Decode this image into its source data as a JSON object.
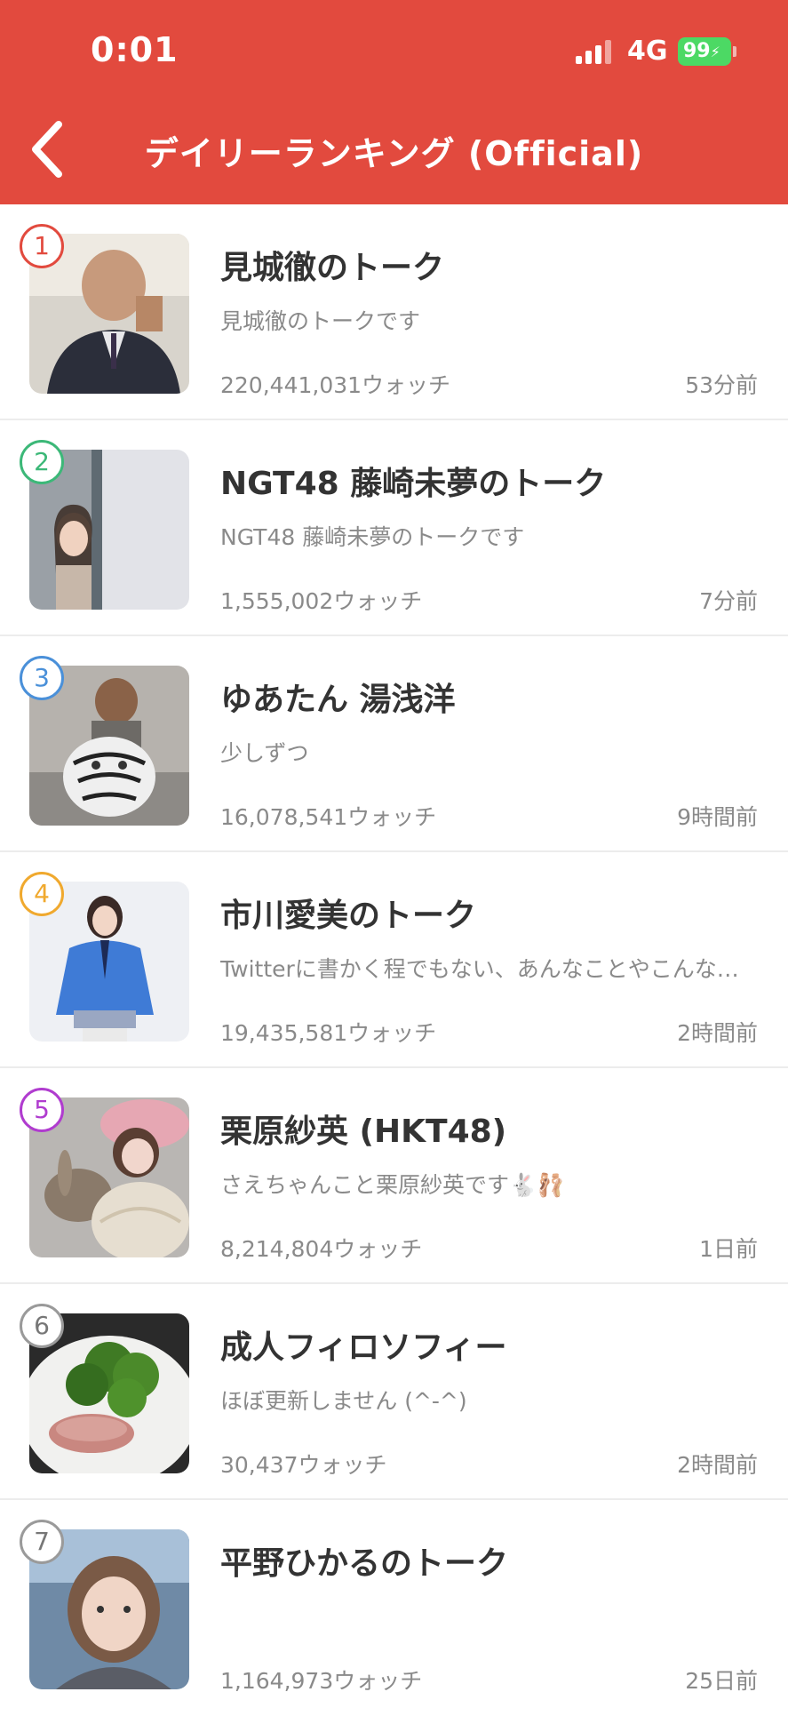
{
  "status_bar": {
    "time": "0:01",
    "network": "4G",
    "battery": "99"
  },
  "header": {
    "back_icon": "chevron-left-icon",
    "title": "デイリーランキング (Official)"
  },
  "ranking": [
    {
      "rank": "1",
      "rank_color": "#e24a3e",
      "name": "見城徹のトーク",
      "description": "見城徹のトークです",
      "watch": "220,441,031ウォッチ",
      "time": "53分前"
    },
    {
      "rank": "2",
      "rank_color": "#3cb878",
      "name": "NGT48 藤崎未夢のトーク",
      "description": "NGT48 藤崎未夢のトークです",
      "watch": "1,555,002ウォッチ",
      "time": "7分前"
    },
    {
      "rank": "3",
      "rank_color": "#4a90d9",
      "name": "ゆあたん 湯浅洋",
      "description": "少しずつ",
      "watch": "16,078,541ウォッチ",
      "time": "9時間前"
    },
    {
      "rank": "4",
      "rank_color": "#f0a92e",
      "name": "市川愛美のトーク",
      "description": "Twitterに書かく程でもない、あんなことやこんな…",
      "watch": "19,435,581ウォッチ",
      "time": "2時間前"
    },
    {
      "rank": "5",
      "rank_color": "#b03ccf",
      "name": "栗原紗英 (HKT48)",
      "description": "さえちゃんこと栗原紗英です🐇🩰",
      "watch": "8,214,804ウォッチ",
      "time": "1日前"
    },
    {
      "rank": "6",
      "rank_color": "#9a9a9a",
      "name": "成人フィロソフィー",
      "description": "ほぼ更新しません (^-^)",
      "watch": "30,437ウォッチ",
      "time": "2時間前"
    },
    {
      "rank": "7",
      "rank_color": "#9a9a9a",
      "name": "平野ひかるのトーク",
      "description": "",
      "watch": "1,164,973ウォッチ",
      "time": "25日前"
    }
  ]
}
